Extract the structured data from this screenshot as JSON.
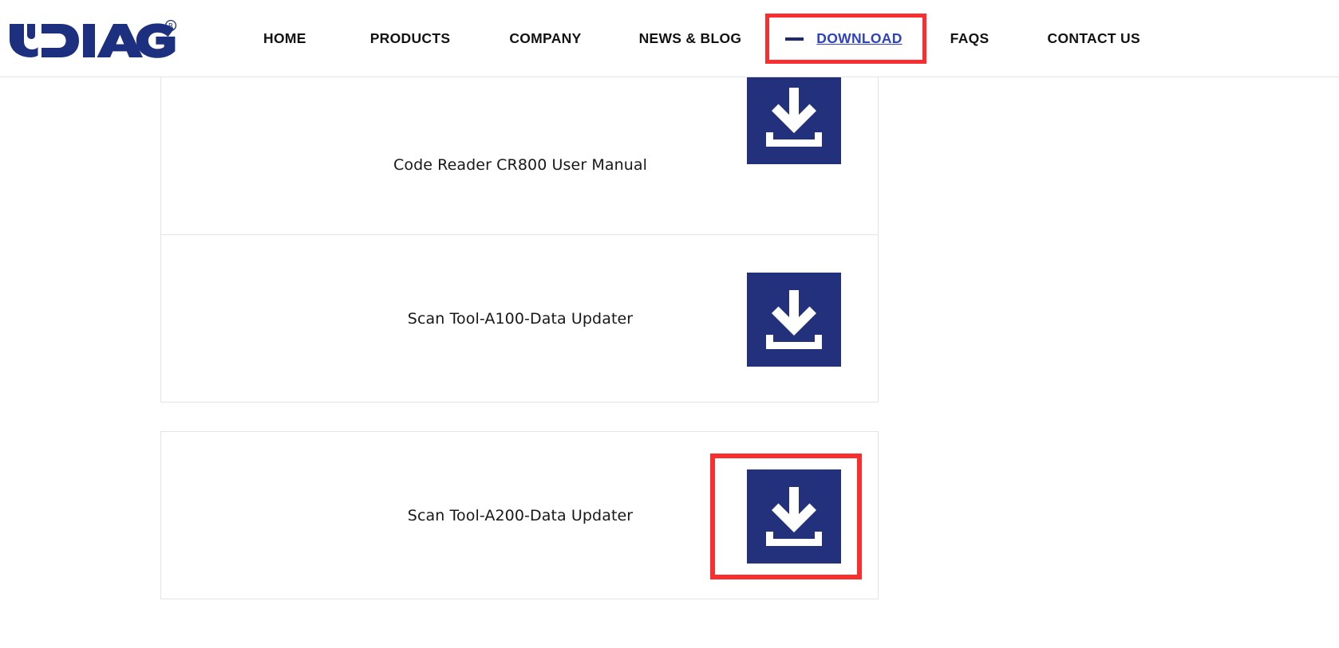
{
  "header": {
    "logo": {
      "name": "udiag-logo",
      "text": "UDIAG",
      "registered_mark": "®",
      "color": "#1d3080"
    },
    "nav_items": [
      {
        "label": "HOME",
        "active": false
      },
      {
        "label": "PRODUCTS",
        "active": false
      },
      {
        "label": "COMPANY",
        "active": false
      },
      {
        "label": "NEWS & BLOG",
        "active": false
      },
      {
        "label": "DOWNLOAD",
        "active": true
      },
      {
        "label": "FAQS",
        "active": false
      },
      {
        "label": "CONTACT US",
        "active": false
      }
    ],
    "active_item": {
      "label": "DOWNLOAD",
      "color": "#2f43c0",
      "dash_color": "#1d2b6e",
      "highlight_color": "#fa2e2e"
    }
  },
  "downloads": {
    "items": [
      {
        "title": "Code Reader CR800 User Manual",
        "button_label": "download-icon",
        "highlighted": false
      },
      {
        "title": "Scan Tool-A100-Data Updater",
        "button_label": "download-icon",
        "highlighted": false
      },
      {
        "title": "Scan Tool-A200-Data Updater",
        "button_label": "download-icon",
        "highlighted": true
      }
    ]
  },
  "colors": {
    "brand_navy": "#23307c",
    "logo_navy": "#1d3080",
    "highlight_red": "#fa2e2e",
    "card_border": "#e4e4e4",
    "nav_text": "#121212",
    "body_text": "#181818",
    "page_background": "#ffffff"
  }
}
